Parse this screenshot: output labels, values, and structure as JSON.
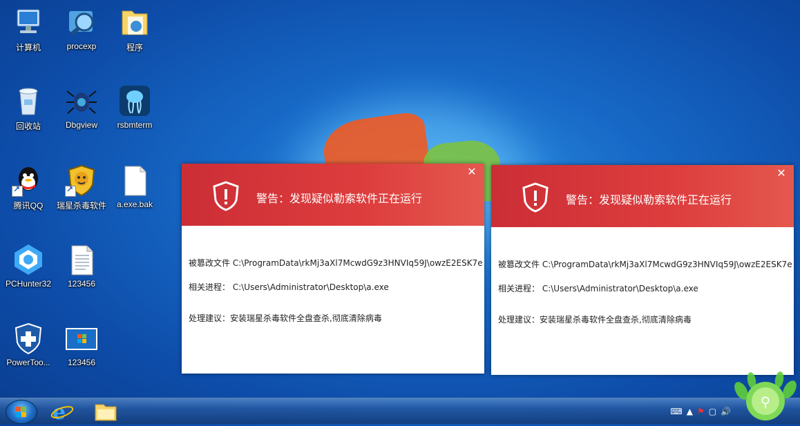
{
  "desktop": {
    "icons": [
      {
        "label": "计算机",
        "icon": "computer-icon"
      },
      {
        "label": "procexp",
        "icon": "procexp-icon"
      },
      {
        "label": "程序",
        "icon": "folder-icon"
      },
      {
        "label": "回收站",
        "icon": "recycle-bin-icon"
      },
      {
        "label": "Dbgview",
        "icon": "dbgview-icon"
      },
      {
        "label": "rsbmterm",
        "icon": "rsbmterm-icon"
      },
      {
        "label": "腾讯QQ",
        "icon": "qq-icon"
      },
      {
        "label": "瑞星杀毒软件",
        "icon": "rising-antivirus-icon"
      },
      {
        "label": "a.exe.bak",
        "icon": "file-icon"
      },
      {
        "label": "PCHunter32",
        "icon": "pchunter-icon"
      },
      {
        "label": "123456",
        "icon": "text-file-icon"
      },
      {
        "label": "PowerToo...",
        "icon": "powertool-icon"
      },
      {
        "label": "123456",
        "icon": "image-file-icon"
      }
    ]
  },
  "alerts": [
    {
      "title": "警告：发现疑似勒索软件正在运行",
      "file_line": "被篡改文件 C:\\ProgramData\\rkMj3aXl7McwdG9z3HNVIq59J\\owzE2ESK7e",
      "process_line": "相关进程： C:\\Users\\Administrator\\Desktop\\a.exe",
      "advice_line": "处理建议：安装瑞星杀毒软件全盘查杀,彻底清除病毒",
      "close_label": "✕"
    },
    {
      "title": "警告：发现疑似勒索软件正在运行",
      "file_line": "被篡改文件 C:\\ProgramData\\rkMj3aXl7McwdG9z3HNVIq59J\\owzE2ESK7e",
      "process_line": "相关进程： C:\\Users\\Administrator\\Desktop\\a.exe",
      "advice_line": "处理建议：安装瑞星杀毒软件全盘查杀,彻底清除病毒",
      "close_label": "✕"
    }
  ],
  "taskbar": {
    "apps": [
      {
        "icon": "internet-explorer-icon"
      },
      {
        "icon": "file-explorer-icon"
      }
    ],
    "tray_icons": [
      "keyboard-icon",
      "show-hidden-icon",
      "flag-icon",
      "network-icon",
      "volume-icon"
    ]
  },
  "colors": {
    "alert_header": "#d6363c",
    "desktop_bg": "#1768c6"
  }
}
